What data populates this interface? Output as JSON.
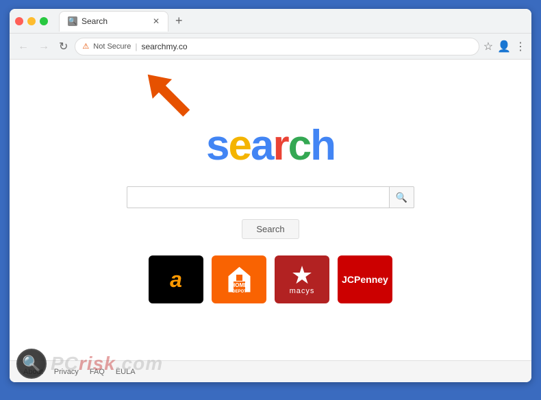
{
  "browser": {
    "tab": {
      "title": "Search",
      "favicon": "🔍"
    },
    "new_tab_label": "+",
    "nav": {
      "back": "←",
      "forward": "→",
      "refresh": "↻"
    },
    "address_bar": {
      "security_label": "Not Secure",
      "url": "searchmy.co"
    },
    "address_actions": {
      "bookmark": "☆",
      "profile": "👤",
      "menu": "⋮"
    }
  },
  "page": {
    "logo_letters": [
      "s",
      "e",
      "a",
      "r",
      "c",
      "h"
    ],
    "search_placeholder": "",
    "search_button_label": "Search",
    "brands": [
      {
        "name": "Amazon",
        "bg": "#000",
        "text_color": "#f90",
        "display": "a"
      },
      {
        "name": "Home Depot",
        "bg": "#f96302",
        "display": "HD"
      },
      {
        "name": "Macys",
        "bg": "#b22222",
        "display": "★",
        "sub": "macys"
      },
      {
        "name": "JCPenney",
        "bg": "#cc0000",
        "display": "JCPenney"
      }
    ]
  },
  "footer": {
    "links": [
      "About",
      "Privacy",
      "FAQ",
      "EULA"
    ]
  },
  "arrow": {
    "color": "#e65100"
  }
}
